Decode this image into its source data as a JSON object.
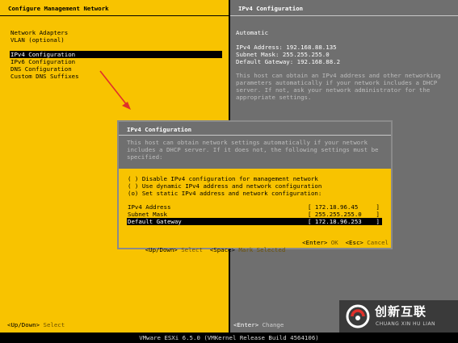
{
  "left_panel": {
    "title": "Configure Management Network",
    "menu": [
      {
        "label": "Network Adapters",
        "selected": false
      },
      {
        "label": "VLAN (optional)",
        "selected": false
      },
      {
        "label": "",
        "selected": false
      },
      {
        "label": "IPv4 Configuration",
        "selected": true
      },
      {
        "label": "IPv6 Configuration",
        "selected": false
      },
      {
        "label": "DNS Configuration",
        "selected": false
      },
      {
        "label": "Custom DNS Suffixes",
        "selected": false
      }
    ],
    "footer": {
      "key": "<Up/Down>",
      "action": "Select"
    }
  },
  "right_panel": {
    "title": "IPv4 Configuration",
    "mode": "Automatic",
    "ipv4_address": "IPv4 Address: 192.168.88.135",
    "subnet_mask": "Subnet Mask: 255.255.255.0",
    "default_gateway": "Default Gateway: 192.168.88.2",
    "description": "This host can obtain an IPv4 address and other networking parameters automatically if your network includes a DHCP server. If not, ask your network administrator for the appropriate settings.",
    "footer": {
      "key": "<Enter>",
      "action": "Change"
    }
  },
  "dialog": {
    "title": "IPv4 Configuration",
    "description": "This host can obtain network settings automatically if your network includes a DHCP server. If it does not, the following settings must be specified:",
    "options": [
      {
        "marker": "( )",
        "label": "Disable IPv4 configuration for management network"
      },
      {
        "marker": "( )",
        "label": "Use dynamic IPv4 address and network configuration"
      },
      {
        "marker": "(o)",
        "label": "Set static IPv4 address and network configuration:"
      }
    ],
    "fields": [
      {
        "label": "IPv4 Address",
        "value": "[ 172.18.96.45     ]",
        "selected": false
      },
      {
        "label": "Subnet Mask",
        "value": "[ 255.255.255.0    ]",
        "selected": false
      },
      {
        "label": "Default Gateway",
        "value": "[ 172.18.96.253    ]",
        "selected": true
      }
    ],
    "footer": {
      "nav_key": "<Up/Down>",
      "nav_action": "Select",
      "space_key": "<Space>",
      "space_action": "Mark Selected",
      "ok_key": "<Enter>",
      "ok_action": "OK",
      "cancel_key": "<Esc>",
      "cancel_action": "Cancel"
    }
  },
  "status_bar": "VMware ESXi 6.5.0 (VMKernel Release Build 4564106)",
  "watermark": {
    "cn": "创新互联",
    "en": "CHUANG XIN HU LIAN"
  },
  "colors": {
    "yellow": "#f8c300",
    "gray": "#6f6f6f",
    "arrow": "#e0302a"
  }
}
